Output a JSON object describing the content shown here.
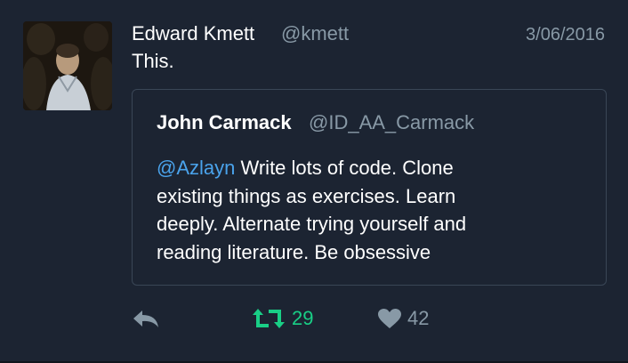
{
  "tweet": {
    "author": {
      "name": "Edward Kmett",
      "handle": "@kmett"
    },
    "timestamp": "3/06/2016",
    "text": "This."
  },
  "quoted_tweet": {
    "author": {
      "name": "John Carmack",
      "handle": "@ID_AA_Carmack"
    },
    "mention": "@Azlayn",
    "text_line1": " Write lots of code. Clone",
    "text_line2": "existing things as exercises. Learn",
    "text_line3": "deeply. Alternate trying yourself and",
    "text_line4": "reading literature. Be obsessive"
  },
  "actions": {
    "reply_icon": "reply-icon",
    "retweet_icon": "retweet-icon",
    "retweet_count": "29",
    "like_icon": "heart-icon",
    "like_count": "42"
  },
  "colors": {
    "background": "#1c2432",
    "mention": "#4aa3ec",
    "retweet": "#19cf86",
    "muted": "#8899a6"
  }
}
